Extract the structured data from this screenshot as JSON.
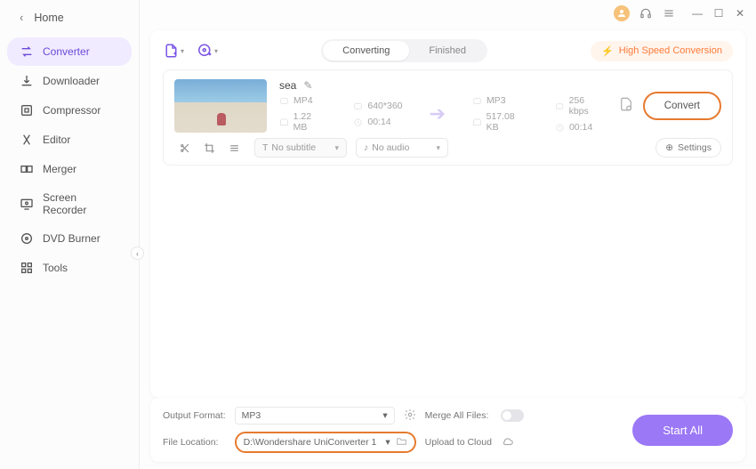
{
  "home": "Home",
  "sidebar": [
    {
      "label": "Converter"
    },
    {
      "label": "Downloader"
    },
    {
      "label": "Compressor"
    },
    {
      "label": "Editor"
    },
    {
      "label": "Merger"
    },
    {
      "label": "Screen Recorder"
    },
    {
      "label": "DVD Burner"
    },
    {
      "label": "Tools"
    }
  ],
  "tabs": {
    "converting": "Converting",
    "finished": "Finished"
  },
  "highspeed": "High Speed Conversion",
  "file": {
    "name": "sea",
    "src_fmt": "MP4",
    "src_res": "640*360",
    "src_size": "1.22 MB",
    "src_dur": "00:14",
    "dst_fmt": "MP3",
    "dst_br": "256 kbps",
    "dst_size": "517.08 KB",
    "dst_dur": "00:14",
    "subtitle": "No subtitle",
    "audio": "No audio",
    "settings": "Settings",
    "convert": "Convert"
  },
  "footer": {
    "output_format_lbl": "Output Format:",
    "output_format": "MP3",
    "merge_lbl": "Merge All Files:",
    "file_location_lbl": "File Location:",
    "file_location": "D:\\Wondershare UniConverter 1",
    "upload_lbl": "Upload to Cloud",
    "start_all": "Start All"
  }
}
